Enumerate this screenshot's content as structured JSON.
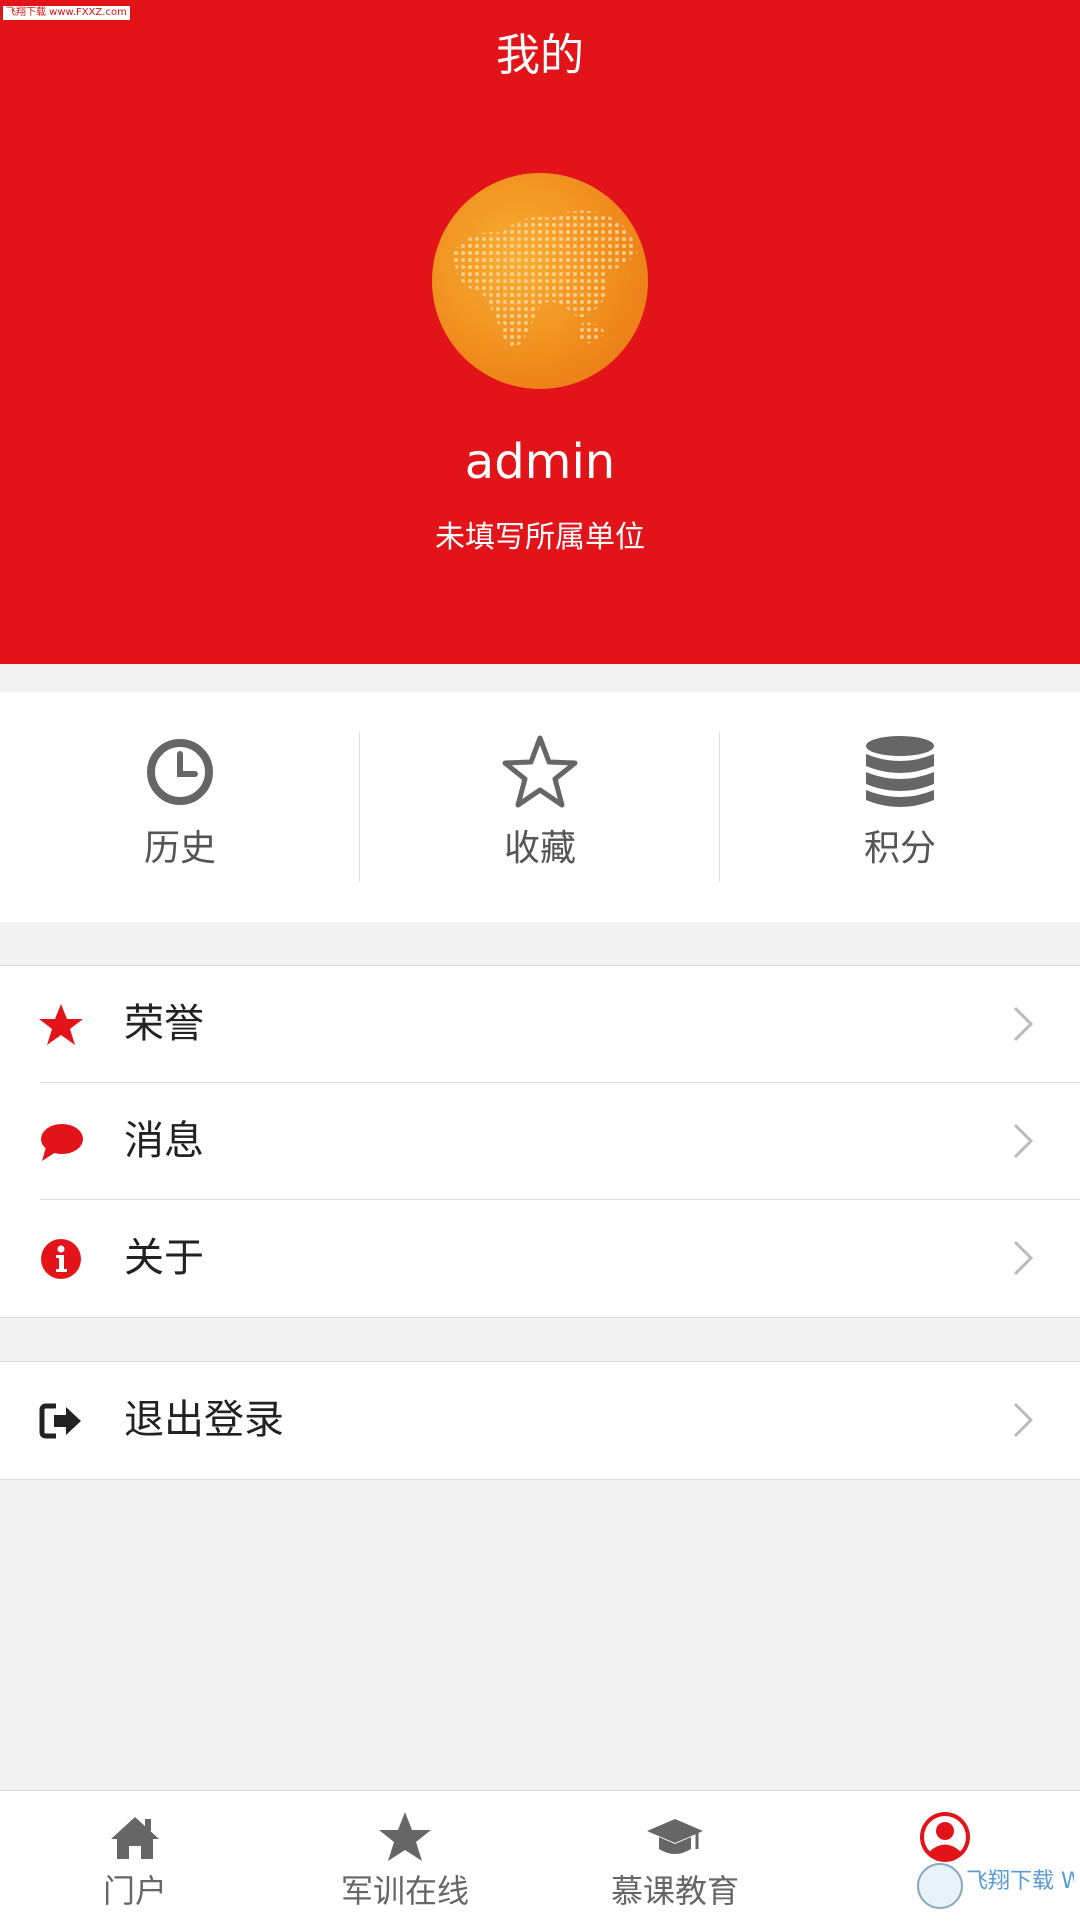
{
  "watermark_top": "飞翔下载 www.FXXZ.com",
  "header": {
    "title": "我的",
    "username": "admin",
    "unit": "未填写所属单位"
  },
  "quick_actions": [
    {
      "label": "历史",
      "icon": "clock-icon"
    },
    {
      "label": "收藏",
      "icon": "star-outline-icon"
    },
    {
      "label": "积分",
      "icon": "database-icon"
    }
  ],
  "menu": [
    {
      "label": "荣誉",
      "icon": "star-icon",
      "color": "#e31419"
    },
    {
      "label": "消息",
      "icon": "chat-bubble-icon",
      "color": "#e31419"
    },
    {
      "label": "关于",
      "icon": "info-icon",
      "color": "#e31419"
    }
  ],
  "logout": {
    "label": "退出登录",
    "icon": "sign-out-icon"
  },
  "tabs": [
    {
      "label": "门户",
      "icon": "home-icon"
    },
    {
      "label": "军训在线",
      "icon": "star-icon"
    },
    {
      "label": "慕课教育",
      "icon": "graduation-cap-icon"
    },
    {
      "label": "",
      "icon": "user-icon",
      "active": true
    }
  ],
  "watermark_bottom": "飞翔下载 WWW.FXXZ.COM",
  "colors": {
    "accent": "#e31419",
    "icon_gray": "#666666",
    "background": "#f2f2f2"
  }
}
